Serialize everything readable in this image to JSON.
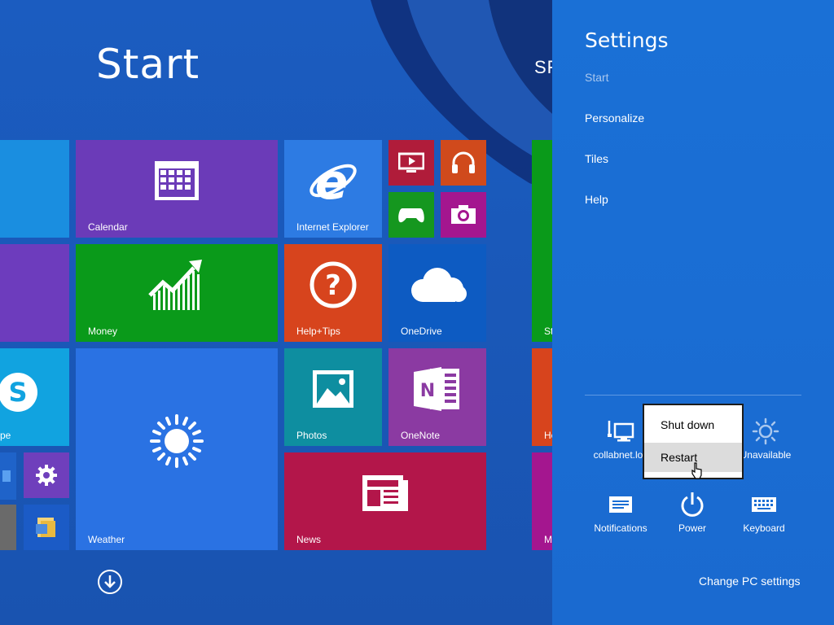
{
  "start_screen": {
    "title": "Start",
    "user_name_partial": "SF",
    "all_apps_icon": "arrow-down-circle-icon",
    "tiles": [
      {
        "id": "calendar",
        "label": "Calendar",
        "color": "#6b3bb8",
        "icon": "calendar-icon"
      },
      {
        "id": "internet-explorer",
        "label": "Internet Explorer",
        "color": "#2d7be3",
        "icon": "internet-explorer-icon"
      },
      {
        "id": "video",
        "label": "",
        "color": "#b01c3a",
        "icon": "video-icon"
      },
      {
        "id": "music",
        "label": "",
        "color": "#d04a1c",
        "icon": "headphones-icon"
      },
      {
        "id": "games",
        "label": "",
        "color": "#15971f",
        "icon": "xbox-controller-icon"
      },
      {
        "id": "camera",
        "label": "",
        "color": "#a4168f",
        "icon": "camera-icon"
      },
      {
        "id": "money",
        "label": "Money",
        "color": "#0a9a1a",
        "icon": "chart-growth-icon"
      },
      {
        "id": "help-tips",
        "label": "Help+Tips",
        "color": "#d7441d",
        "icon": "question-mark-icon"
      },
      {
        "id": "onedrive",
        "label": "OneDrive",
        "color": "#0d5bc2",
        "icon": "cloud-icon"
      },
      {
        "id": "skype",
        "label": "pe",
        "color": "#11a3e0",
        "icon": "skype-icon"
      },
      {
        "id": "weather",
        "label": "Weather",
        "color": "#2a72e3",
        "icon": "sun-icon"
      },
      {
        "id": "photos",
        "label": "Photos",
        "color": "#0e8ea0",
        "icon": "photo-icon"
      },
      {
        "id": "onenote",
        "label": "OneNote",
        "color": "#8b3aa2",
        "icon": "onenote-icon"
      },
      {
        "id": "news",
        "label": "News",
        "color": "#b3164a",
        "icon": "news-icon"
      },
      {
        "id": "pc-settings",
        "label": "",
        "color": "#6f3fbc",
        "icon": "gear-icon"
      },
      {
        "id": "file-explorer",
        "label": "",
        "color": "#1b5bc6",
        "icon": "folder-icon"
      },
      {
        "id": "desktop-partial",
        "label": "",
        "color": "#1f63c9",
        "icon": "desktop-icon"
      },
      {
        "id": "store-partial",
        "label": "St",
        "color": "#0a9a1a",
        "icon": ""
      },
      {
        "id": "health-partial",
        "label": "He",
        "color": "#d7441d",
        "icon": ""
      },
      {
        "id": "maps-partial",
        "label": "M",
        "color": "#a4168f",
        "icon": ""
      }
    ]
  },
  "settings_pane": {
    "title": "Settings",
    "links": [
      "Start",
      "Personalize",
      "Tiles",
      "Help"
    ],
    "quick_settings": [
      {
        "label": "collabnet.loc",
        "icon": "network-icon"
      },
      {
        "label": "Unavailable",
        "icon": "brightness-icon"
      },
      {
        "label": "Notifications",
        "icon": "notifications-icon"
      },
      {
        "label": "Power",
        "icon": "power-icon"
      },
      {
        "label": "Keyboard",
        "icon": "keyboard-icon"
      }
    ],
    "change_pc_settings": "Change PC settings"
  },
  "power_menu": {
    "items": [
      "Shut down",
      "Restart"
    ],
    "hovered": "Restart"
  },
  "colors": {
    "start_background": "#1b5cc0",
    "charm_background": "#1a6ed4"
  }
}
